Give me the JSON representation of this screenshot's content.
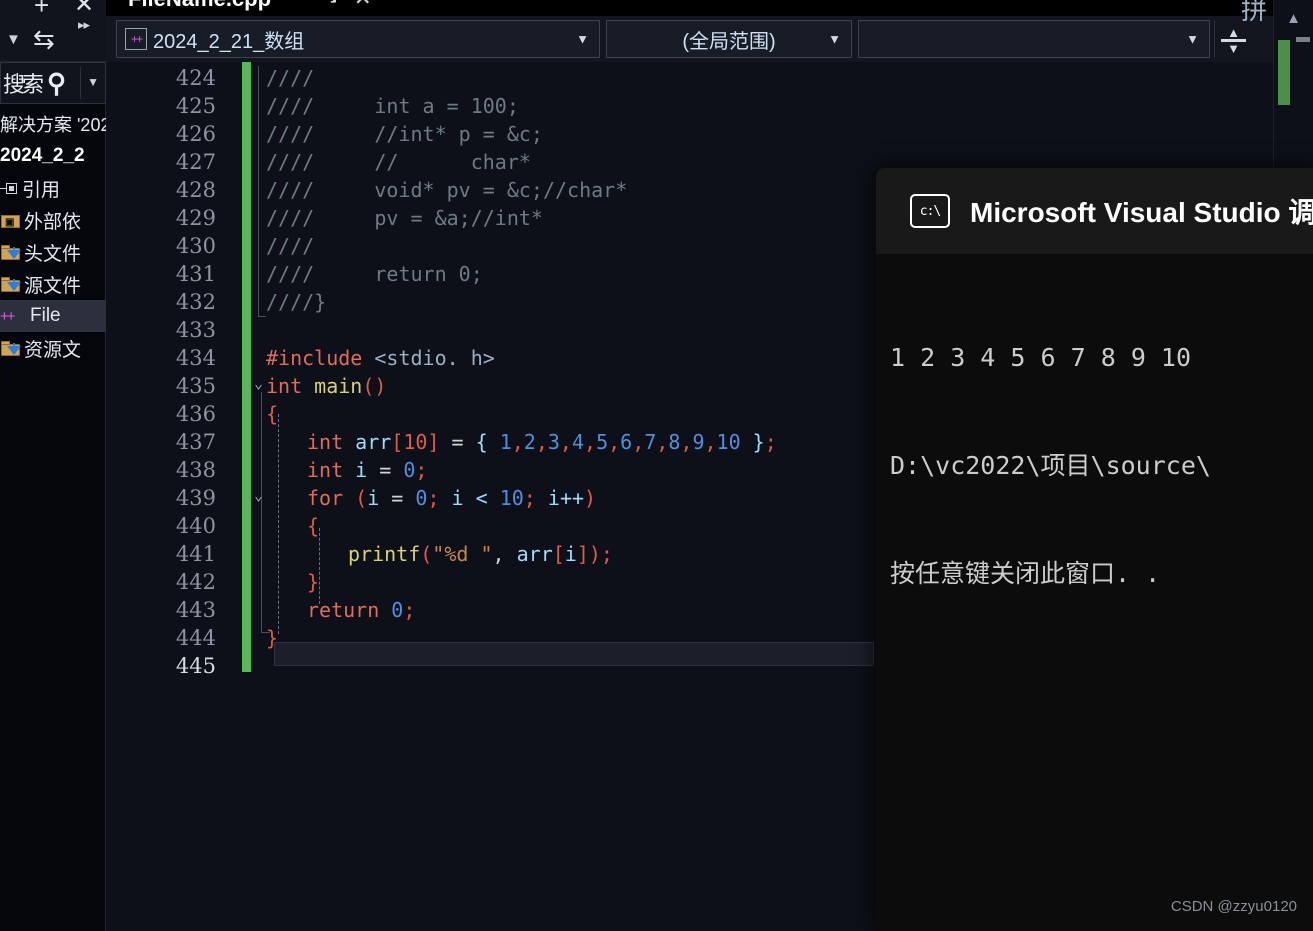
{
  "app": {
    "watermark": "CSDN @zzyu0120"
  },
  "solution_explorer": {
    "toolbar": {
      "add_icon": "plus-icon",
      "close_icon": "close-icon",
      "caret_icon": "chevron-down-icon",
      "sync_icon": "sync-arrows-icon",
      "more_icon": "chevron-double-right-icon"
    },
    "search": {
      "label": "搜索",
      "icon": "search-icon",
      "dropdown_icon": "chevron-down-icon"
    },
    "items": [
      {
        "label": "解决方案 '202",
        "icon": "solution-icon",
        "type": "solution",
        "selected": false
      },
      {
        "label": "2024_2_2",
        "icon": "project-icon",
        "type": "project",
        "selected": false
      },
      {
        "label": "引用",
        "icon": "references-icon",
        "type": "references",
        "selected": false
      },
      {
        "label": "外部依",
        "icon": "external-dependencies-icon",
        "type": "folder",
        "selected": false
      },
      {
        "label": "头文件",
        "icon": "folder-filter-icon",
        "type": "folder",
        "selected": false
      },
      {
        "label": "源文件",
        "icon": "folder-filter-icon",
        "type": "folder",
        "selected": false
      },
      {
        "label": "File",
        "icon": "cpp-file-icon",
        "type": "file",
        "selected": true
      },
      {
        "label": "资源文",
        "icon": "folder-filter-icon",
        "type": "folder",
        "selected": false
      }
    ]
  },
  "editor": {
    "tab": {
      "filename": "FileName.cpp",
      "pin_icon": "pin-icon",
      "close_icon": "close-icon"
    },
    "navbar": {
      "project_badge_icon": "cpp-icon",
      "project": "2024_2_21_数组",
      "scope": "(全局范围)",
      "member": "",
      "dropdown_icon": "chevron-down-icon",
      "split_icon": "split-editor-icon"
    },
    "scrollbar": {
      "up_icon": "chevron-up-icon"
    },
    "lines": [
      {
        "n": "424",
        "indent": 0,
        "tokens": [
          {
            "t": "////",
            "c": "k-comg"
          }
        ]
      },
      {
        "n": "425",
        "indent": 0,
        "tokens": [
          {
            "t": "////     int a = 100;",
            "c": "k-comg"
          }
        ]
      },
      {
        "n": "426",
        "indent": 0,
        "tokens": [
          {
            "t": "////     //int* p = &c;",
            "c": "k-comg"
          }
        ]
      },
      {
        "n": "427",
        "indent": 0,
        "tokens": [
          {
            "t": "////     //      char*",
            "c": "k-comg"
          }
        ]
      },
      {
        "n": "428",
        "indent": 0,
        "tokens": [
          {
            "t": "////     void* pv = &c;//char*",
            "c": "k-comg"
          }
        ]
      },
      {
        "n": "429",
        "indent": 0,
        "tokens": [
          {
            "t": "////     pv = &a;//int*",
            "c": "k-comg"
          }
        ]
      },
      {
        "n": "430",
        "indent": 0,
        "tokens": [
          {
            "t": "////",
            "c": "k-comg"
          }
        ]
      },
      {
        "n": "431",
        "indent": 0,
        "tokens": [
          {
            "t": "////     return 0;",
            "c": "k-comg"
          }
        ]
      },
      {
        "n": "432",
        "indent": 0,
        "tokens": [
          {
            "t": "////}",
            "c": "k-comg"
          }
        ]
      },
      {
        "n": "433",
        "indent": 0,
        "tokens": []
      },
      {
        "n": "434",
        "indent": 0,
        "tokens": [
          {
            "t": "#include ",
            "c": "k-kw"
          },
          {
            "t": "<stdio. h>",
            "c": "k-inc"
          }
        ]
      },
      {
        "n": "435",
        "indent": 0,
        "tokens": [
          {
            "t": "int ",
            "c": "k-type"
          },
          {
            "t": "main",
            "c": "k-fn"
          },
          {
            "t": "()",
            "c": "k-brk"
          }
        ]
      },
      {
        "n": "436",
        "indent": 0,
        "tokens": [
          {
            "t": "{",
            "c": "k-brk"
          }
        ]
      },
      {
        "n": "437",
        "indent": 1,
        "tokens": [
          {
            "t": "int ",
            "c": "k-type"
          },
          {
            "t": "arr",
            "c": "k-id"
          },
          {
            "t": "[10]",
            "c": "k-brk"
          },
          {
            "t": " = ",
            "c": "k-punc"
          },
          {
            "t": "{ ",
            "c": "k-id"
          },
          {
            "t": "1",
            "c": "k-num"
          },
          {
            "t": ",",
            "c": "k-brk"
          },
          {
            "t": "2",
            "c": "k-num"
          },
          {
            "t": ",",
            "c": "k-brk"
          },
          {
            "t": "3",
            "c": "k-num"
          },
          {
            "t": ",",
            "c": "k-brk"
          },
          {
            "t": "4",
            "c": "k-num"
          },
          {
            "t": ",",
            "c": "k-brk"
          },
          {
            "t": "5",
            "c": "k-num"
          },
          {
            "t": ",",
            "c": "k-brk"
          },
          {
            "t": "6",
            "c": "k-num"
          },
          {
            "t": ",",
            "c": "k-brk"
          },
          {
            "t": "7",
            "c": "k-num"
          },
          {
            "t": ",",
            "c": "k-brk"
          },
          {
            "t": "8",
            "c": "k-num"
          },
          {
            "t": ",",
            "c": "k-brk"
          },
          {
            "t": "9",
            "c": "k-num"
          },
          {
            "t": ",",
            "c": "k-brk"
          },
          {
            "t": "10",
            "c": "k-num"
          },
          {
            "t": " }",
            "c": "k-id"
          },
          {
            "t": ";",
            "c": "k-brk"
          }
        ]
      },
      {
        "n": "438",
        "indent": 1,
        "tokens": [
          {
            "t": "int ",
            "c": "k-type"
          },
          {
            "t": "i",
            "c": "k-id"
          },
          {
            "t": " = ",
            "c": "k-punc"
          },
          {
            "t": "0",
            "c": "k-num"
          },
          {
            "t": ";",
            "c": "k-brk"
          }
        ]
      },
      {
        "n": "439",
        "indent": 1,
        "tokens": [
          {
            "t": "for ",
            "c": "k-kw"
          },
          {
            "t": "(",
            "c": "k-brk"
          },
          {
            "t": "i",
            "c": "k-id"
          },
          {
            "t": " = ",
            "c": "k-punc"
          },
          {
            "t": "0",
            "c": "k-num"
          },
          {
            "t": "; ",
            "c": "k-brk"
          },
          {
            "t": "i",
            "c": "k-id"
          },
          {
            "t": " < ",
            "c": "k-op"
          },
          {
            "t": "10",
            "c": "k-num"
          },
          {
            "t": "; ",
            "c": "k-brk"
          },
          {
            "t": "i",
            "c": "k-id"
          },
          {
            "t": "++",
            "c": "k-op"
          },
          {
            "t": ")",
            "c": "k-brk"
          }
        ]
      },
      {
        "n": "440",
        "indent": 1,
        "tokens": [
          {
            "t": "{",
            "c": "k-brk"
          }
        ]
      },
      {
        "n": "441",
        "indent": 2,
        "tokens": [
          {
            "t": "printf",
            "c": "k-fn"
          },
          {
            "t": "(",
            "c": "k-brk"
          },
          {
            "t": "\"%d \"",
            "c": "k-str"
          },
          {
            "t": ", ",
            "c": "k-punc"
          },
          {
            "t": "arr",
            "c": "k-id"
          },
          {
            "t": "[",
            "c": "k-brk"
          },
          {
            "t": "i",
            "c": "k-id"
          },
          {
            "t": "]",
            "c": "k-brk"
          },
          {
            "t": ")",
            "c": "k-brk"
          },
          {
            "t": ";",
            "c": "k-brk"
          }
        ]
      },
      {
        "n": "442",
        "indent": 1,
        "tokens": [
          {
            "t": "}",
            "c": "k-brk"
          }
        ]
      },
      {
        "n": "443",
        "indent": 1,
        "tokens": [
          {
            "t": "return ",
            "c": "k-kw"
          },
          {
            "t": "0",
            "c": "k-num"
          },
          {
            "t": ";",
            "c": "k-brk"
          }
        ]
      },
      {
        "n": "444",
        "indent": 0,
        "tokens": [
          {
            "t": "}",
            "c": "k-brk"
          }
        ]
      },
      {
        "n": "445",
        "indent": 0,
        "current": true,
        "tokens": []
      }
    ]
  },
  "console": {
    "icon": "command-prompt-icon",
    "title": "Microsoft Visual Studio 调试控",
    "lines": [
      "1 2 3 4 5 6 7 8 9 10",
      "D:\\vc2022\\项目\\source\\",
      "按任意键关闭此窗口. ."
    ]
  }
}
